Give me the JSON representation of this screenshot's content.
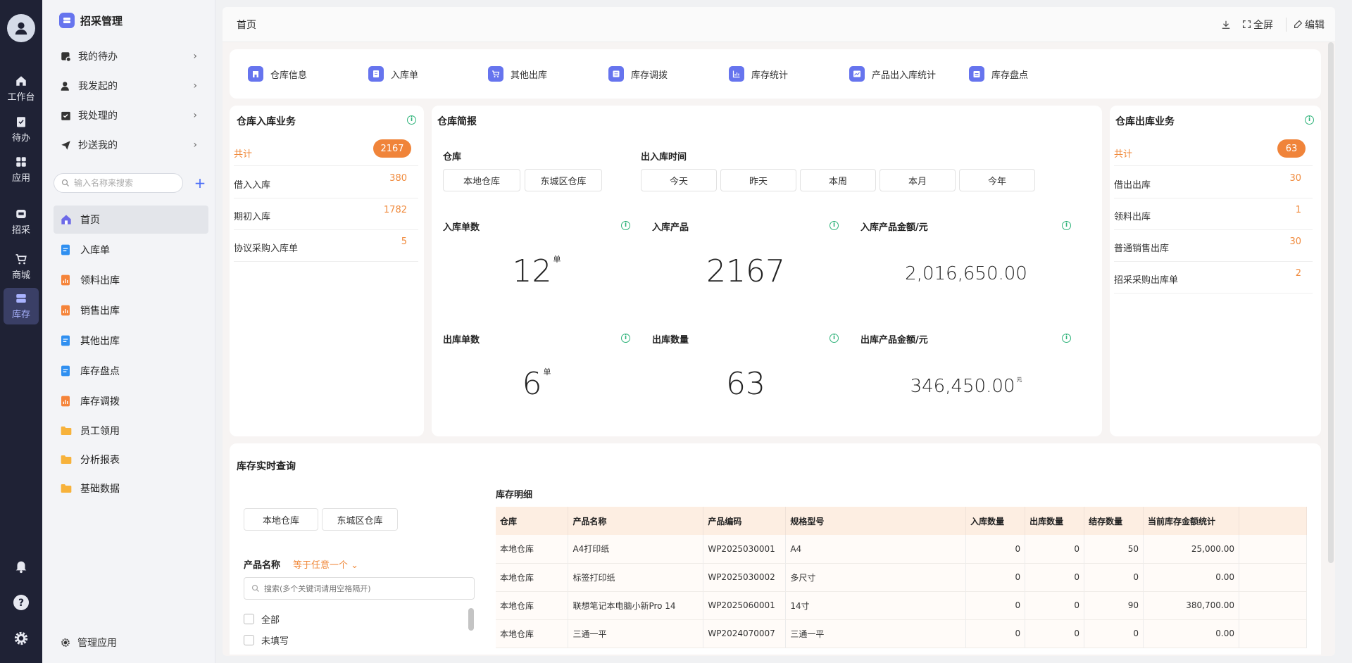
{
  "rail": {
    "items": [
      {
        "label": "工作台"
      },
      {
        "label": "待办"
      },
      {
        "label": "应用"
      },
      {
        "label": "招采"
      },
      {
        "label": "商城"
      },
      {
        "label": "库存"
      }
    ]
  },
  "sidebar": {
    "title": "招采管理",
    "tasks": [
      {
        "label": "我的待办"
      },
      {
        "label": "我发起的"
      },
      {
        "label": "我处理的"
      },
      {
        "label": "抄送我的"
      }
    ],
    "search_placeholder": "输入名称来搜索",
    "nav": [
      {
        "label": "首页",
        "icon": "home-icon"
      },
      {
        "label": "入库单",
        "icon": "doc-icon"
      },
      {
        "label": "领料出库",
        "icon": "chart-doc-icon"
      },
      {
        "label": "销售出库",
        "icon": "chart-doc-icon"
      },
      {
        "label": "其他出库",
        "icon": "doc-icon"
      },
      {
        "label": "库存盘点",
        "icon": "doc-icon"
      },
      {
        "label": "库存调拨",
        "icon": "chart-doc-icon"
      },
      {
        "label": "员工领用",
        "icon": "folder-icon"
      },
      {
        "label": "分析报表",
        "icon": "folder-icon"
      },
      {
        "label": "基础数据",
        "icon": "folder-icon"
      }
    ],
    "manage": "管理应用"
  },
  "header": {
    "title": "首页",
    "fullscreen": "全屏",
    "edit": "编辑"
  },
  "quick": [
    {
      "label": "仓库信息"
    },
    {
      "label": "入库单"
    },
    {
      "label": "其他出库"
    },
    {
      "label": "库存调拨"
    },
    {
      "label": "库存统计"
    },
    {
      "label": "产品出入库统计"
    },
    {
      "label": "库存盘点"
    }
  ],
  "inbound": {
    "title": "仓库入库业务",
    "total_label": "共计",
    "total": "2167",
    "rows": [
      {
        "label": "借入入库",
        "value": "380"
      },
      {
        "label": "期初入库",
        "value": "1782"
      },
      {
        "label": "协议采购入库单",
        "value": "5"
      }
    ]
  },
  "brief": {
    "title": "仓库简报",
    "warehouse_label": "仓库",
    "warehouses": [
      "本地仓库",
      "东城区仓库"
    ],
    "time_label": "出入库时间",
    "times": [
      "今天",
      "昨天",
      "本周",
      "本月",
      "今年"
    ],
    "stats": [
      {
        "label": "入库单数",
        "value": "12",
        "unit": "单"
      },
      {
        "label": "入库产品",
        "value": "2167",
        "unit": ""
      },
      {
        "label": "入库产品金额/元",
        "value": "2,016,650.00",
        "unit": ""
      },
      {
        "label": "出库单数",
        "value": "6",
        "unit": "单"
      },
      {
        "label": "出库数量",
        "value": "63",
        "unit": ""
      },
      {
        "label": "出库产品金额/元",
        "value": "346,450.00",
        "unit": "元"
      }
    ]
  },
  "outbound": {
    "title": "仓库出库业务",
    "total_label": "共计",
    "total": "63",
    "rows": [
      {
        "label": "借出出库",
        "value": "30"
      },
      {
        "label": "领料出库",
        "value": "1"
      },
      {
        "label": "普通销售出库",
        "value": "30"
      },
      {
        "label": "招采采购出库单",
        "value": "2"
      }
    ]
  },
  "realtime": {
    "title": "库存实时查询",
    "warehouses": [
      "本地仓库",
      "东城区仓库"
    ],
    "filter_label": "产品名称",
    "filter_op": "等于任意一个",
    "filter_placeholder": "搜索(多个关键词请用空格隔开)",
    "options": [
      "全部",
      "未填写"
    ],
    "detail_title": "库存明细",
    "columns": [
      "仓库",
      "产品名称",
      "产品编码",
      "规格型号",
      "入库数量",
      "出库数量",
      "结存数量",
      "当前库存金额统计"
    ],
    "rows": [
      [
        "本地仓库",
        "A4打印纸",
        "WP2025030001",
        "A4",
        "0",
        "0",
        "50",
        "25,000.00"
      ],
      [
        "本地仓库",
        "标签打印纸",
        "WP2025030002",
        "多尺寸",
        "0",
        "0",
        "0",
        "0.00"
      ],
      [
        "本地仓库",
        "联想笔记本电脑小新Pro 14",
        "WP2025060001",
        "14寸",
        "0",
        "0",
        "90",
        "380,700.00"
      ],
      [
        "本地仓库",
        "三通一平",
        "WP2024070007",
        "三通一平",
        "0",
        "0",
        "0",
        "0.00"
      ]
    ]
  }
}
